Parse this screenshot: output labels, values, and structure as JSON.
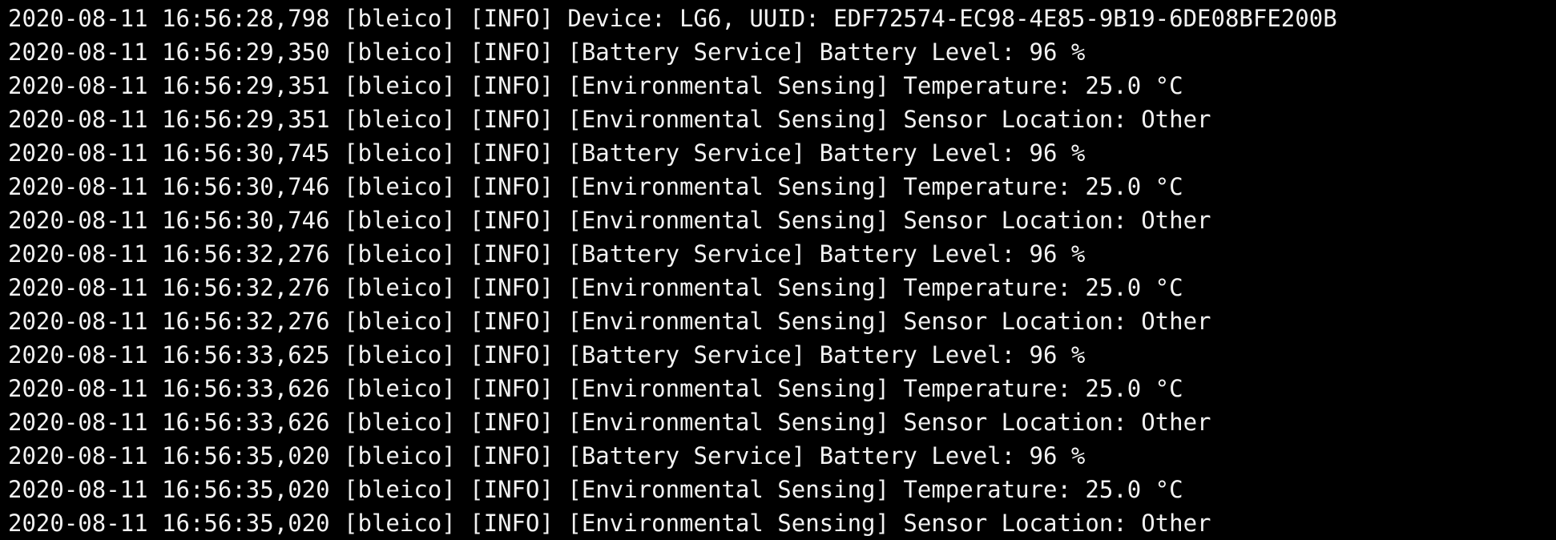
{
  "colors": {
    "background": "#000000",
    "text": "#f2f2f2"
  },
  "log_lines": [
    "2020-08-11 16:56:28,798 [bleico] [INFO] Device: LG6, UUID: EDF72574-EC98-4E85-9B19-6DE08BFE200B",
    "2020-08-11 16:56:29,350 [bleico] [INFO] [Battery Service] Battery Level: 96 %",
    "2020-08-11 16:56:29,351 [bleico] [INFO] [Environmental Sensing] Temperature: 25.0 °C",
    "2020-08-11 16:56:29,351 [bleico] [INFO] [Environmental Sensing] Sensor Location: Other",
    "2020-08-11 16:56:30,745 [bleico] [INFO] [Battery Service] Battery Level: 96 %",
    "2020-08-11 16:56:30,746 [bleico] [INFO] [Environmental Sensing] Temperature: 25.0 °C",
    "2020-08-11 16:56:30,746 [bleico] [INFO] [Environmental Sensing] Sensor Location: Other",
    "2020-08-11 16:56:32,276 [bleico] [INFO] [Battery Service] Battery Level: 96 %",
    "2020-08-11 16:56:32,276 [bleico] [INFO] [Environmental Sensing] Temperature: 25.0 °C",
    "2020-08-11 16:56:32,276 [bleico] [INFO] [Environmental Sensing] Sensor Location: Other",
    "2020-08-11 16:56:33,625 [bleico] [INFO] [Battery Service] Battery Level: 96 %",
    "2020-08-11 16:56:33,626 [bleico] [INFO] [Environmental Sensing] Temperature: 25.0 °C",
    "2020-08-11 16:56:33,626 [bleico] [INFO] [Environmental Sensing] Sensor Location: Other",
    "2020-08-11 16:56:35,020 [bleico] [INFO] [Battery Service] Battery Level: 96 %",
    "2020-08-11 16:56:35,020 [bleico] [INFO] [Environmental Sensing] Temperature: 25.0 °C",
    "2020-08-11 16:56:35,020 [bleico] [INFO] [Environmental Sensing] Sensor Location: Other"
  ]
}
